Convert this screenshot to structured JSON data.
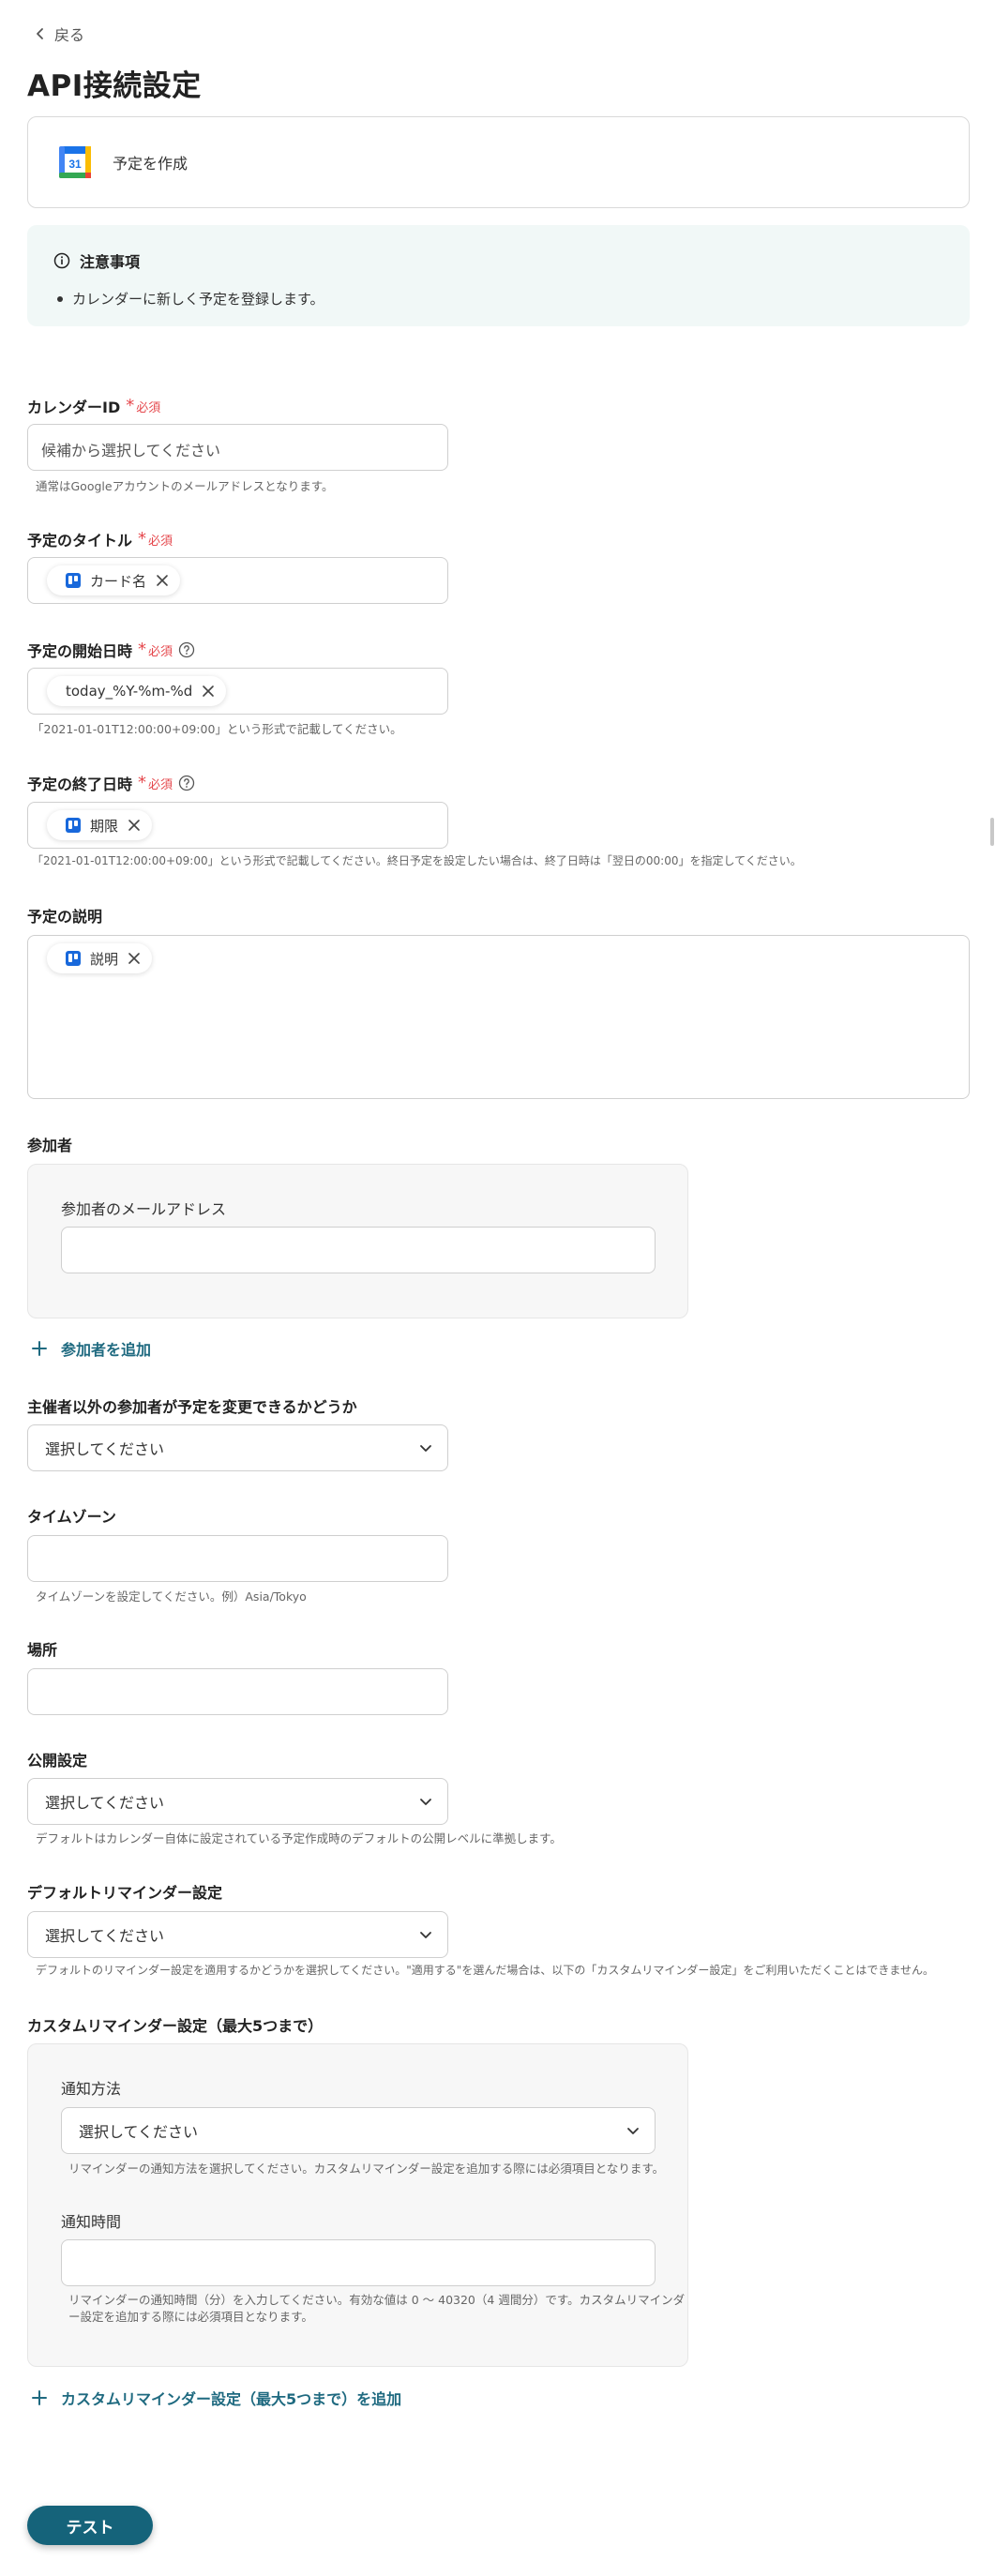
{
  "nav": {
    "back_label": "戻る"
  },
  "page": {
    "title": "API接続設定"
  },
  "action": {
    "label": "予定を作成",
    "icon": "google-calendar-icon",
    "icon_day": "31"
  },
  "notice": {
    "title": "注意事項",
    "items": [
      "カレンダーに新しく予定を登録します。"
    ]
  },
  "required_label": "必須",
  "form": {
    "calendar_id": {
      "label": "カレンダーID",
      "placeholder": "候補から選択してください",
      "hint": "通常はGoogleアカウントのメールアドレスとなります。"
    },
    "title": {
      "label": "予定のタイトル",
      "chip": "カード名"
    },
    "start": {
      "label": "予定の開始日時",
      "chip": "today_%Y-%m-%d",
      "hint": "「2021-01-01T12:00:00+09:00」という形式で記載してください。"
    },
    "end": {
      "label": "予定の終了日時",
      "chip": "期限",
      "hint": "「2021-01-01T12:00:00+09:00」という形式で記載してください。終日予定を設定したい場合は、終了日時は「翌日の00:00」を指定してください。"
    },
    "description": {
      "label": "予定の説明",
      "chip": "説明"
    },
    "attendees": {
      "label": "参加者",
      "email_label": "参加者のメールアドレス",
      "email_value": "",
      "add_label": "参加者を追加"
    },
    "guests_can_modify": {
      "label": "主催者以外の参加者が予定を変更できるかどうか",
      "value": "選択してください"
    },
    "timezone": {
      "label": "タイムゾーン",
      "value": "",
      "hint": "タイムゾーンを設定してください。例）Asia/Tokyo"
    },
    "location": {
      "label": "場所",
      "value": ""
    },
    "visibility": {
      "label": "公開設定",
      "value": "選択してください",
      "hint": "デフォルトはカレンダー自体に設定されている予定作成時のデフォルトの公開レベルに準拠します。"
    },
    "default_reminders": {
      "label": "デフォルトリマインダー設定",
      "value": "選択してください",
      "hint": "デフォルトのリマインダー設定を適用するかどうかを選択してください。\"適用する\"を選んだ場合は、以下の「カスタムリマインダー設定」をご利用いただくことはできません。"
    },
    "custom_reminders": {
      "label": "カスタムリマインダー設定（最大5つまで）",
      "method_label": "通知方法",
      "method_value": "選択してください",
      "method_hint": "リマインダーの通知方法を選択してください。カスタムリマインダー設定を追加する際には必須項目となります。",
      "minutes_label": "通知時間",
      "minutes_value": "",
      "minutes_hint_line1": "リマインダーの通知時間（分）を入力してください。有効な値は 0 〜 40320（4 週間分）です。カスタムリマインダ",
      "minutes_hint_line2": "ー設定を追加する際には必須項目となります。",
      "add_label": "カスタムリマインダー設定（最大5つまで）を追加"
    }
  },
  "footer": {
    "test_label": "テスト"
  },
  "colors": {
    "accent": "#15637a",
    "link": "#1f6a80",
    "required": "#e5484d",
    "notice_bg": "#f1f8f7",
    "trello_blue": "#1868db"
  }
}
